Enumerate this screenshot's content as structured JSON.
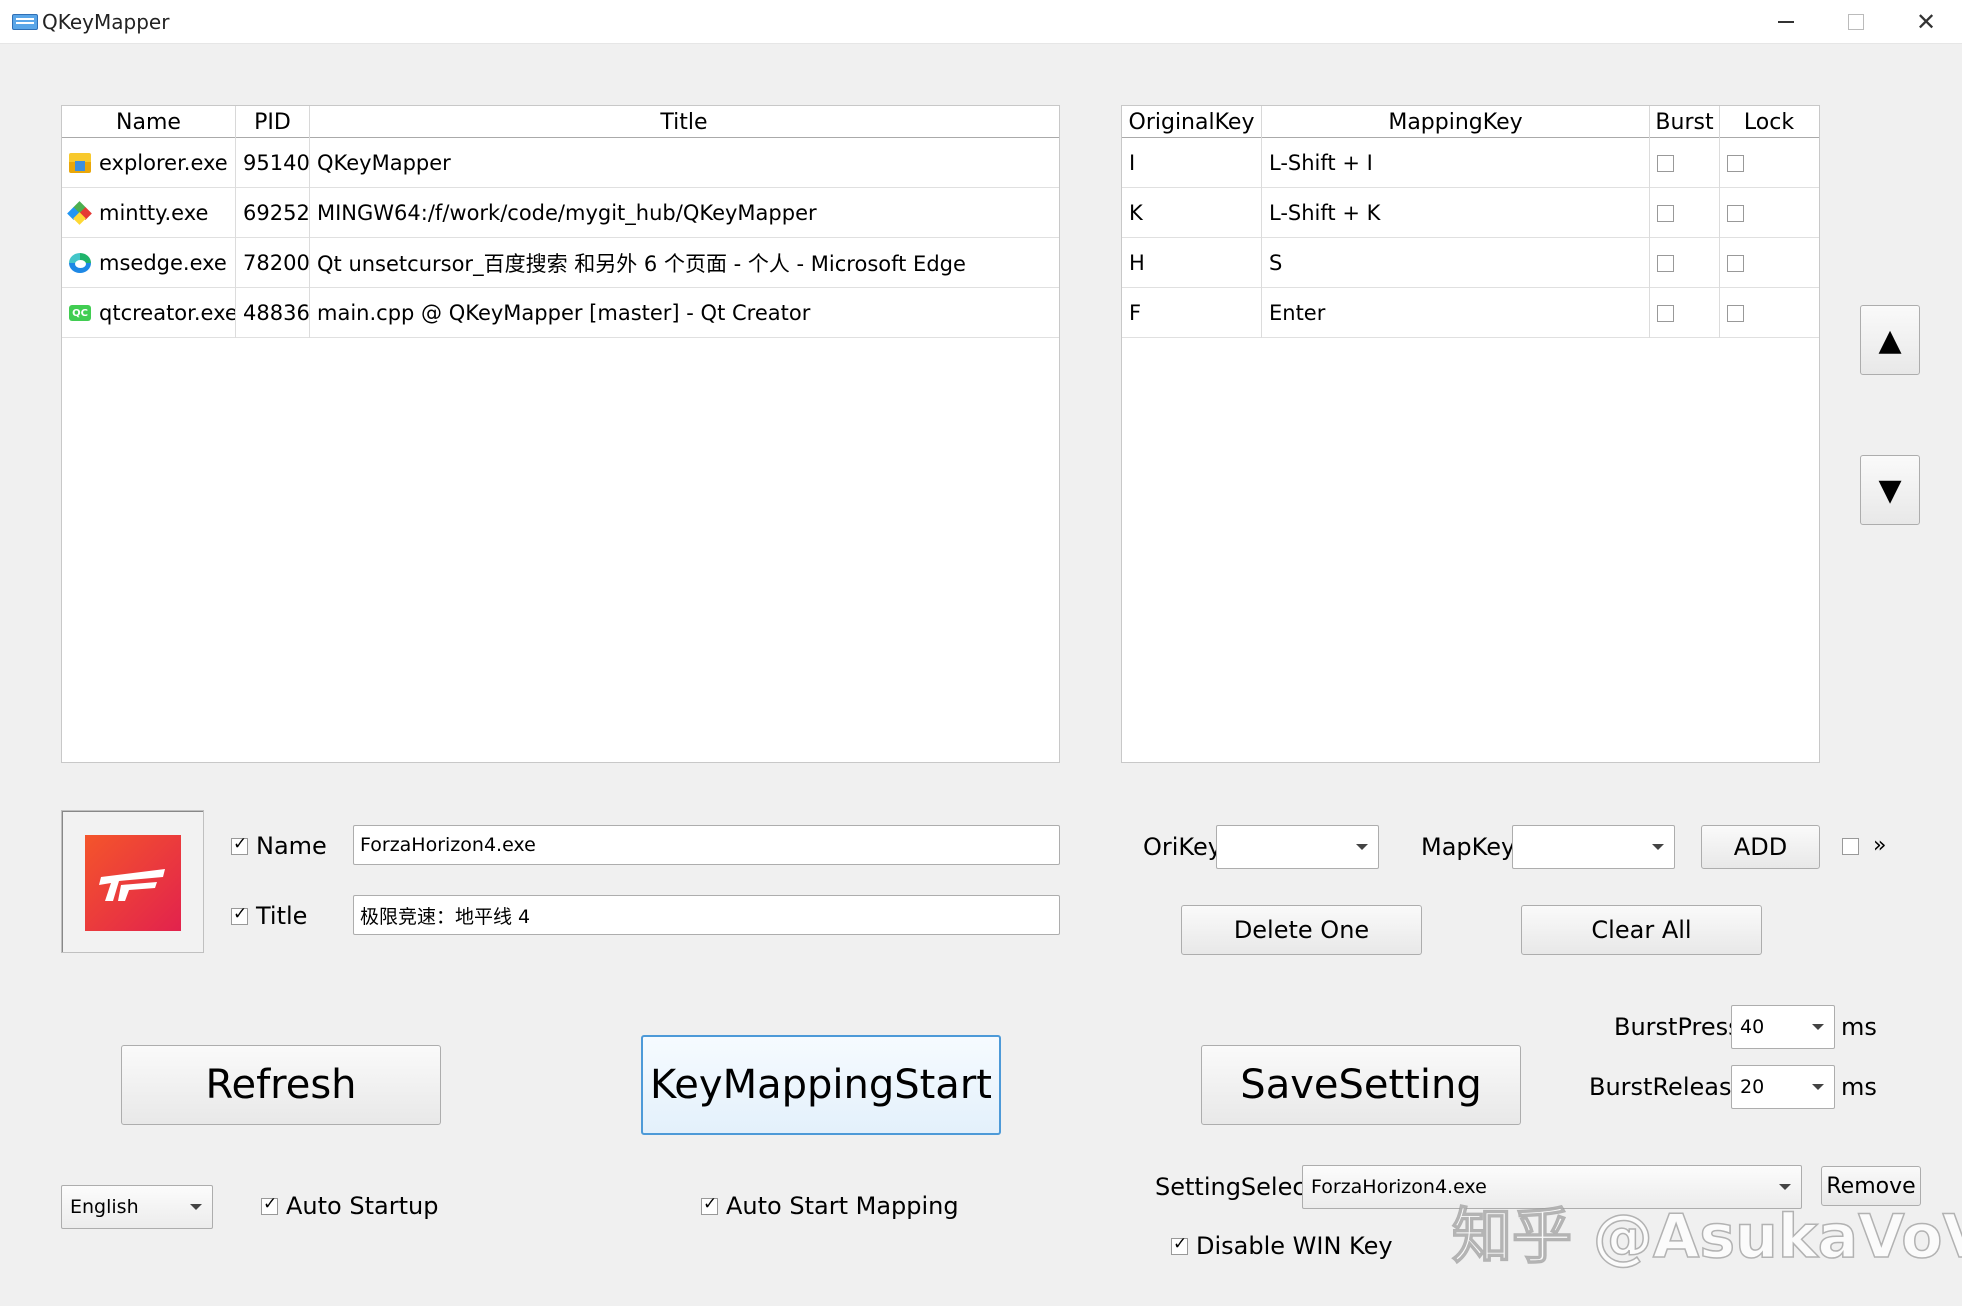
{
  "window": {
    "title": "QKeyMapper",
    "minimize_icon": "minimize-icon",
    "maximize_icon": "maximize-icon",
    "close_glyph": "✕"
  },
  "process_table": {
    "headers": [
      "Name",
      "PID",
      "Title"
    ],
    "rows": [
      {
        "icon": "explorer-icon",
        "name": "explorer.exe",
        "pid": "95140",
        "title": "QKeyMapper"
      },
      {
        "icon": "mintty-icon",
        "name": "mintty.exe",
        "pid": "69252",
        "title": "MINGW64:/f/work/code/mygit_hub/QKeyMapper"
      },
      {
        "icon": "edge-icon",
        "name": "msedge.exe",
        "pid": "78200",
        "title": "Qt unsetcursor_百度搜索 和另外 6 个页面 - 个人 - Microsoft Edge"
      },
      {
        "icon": "qt-creator-icon",
        "name": "qtcreator.exe",
        "pid": "48836",
        "title": "main.cpp @ QKeyMapper [master] - Qt Creator"
      }
    ]
  },
  "mapping_table": {
    "headers": [
      "OriginalKey",
      "MappingKey",
      "Burst",
      "Lock"
    ],
    "rows": [
      {
        "original": "I",
        "mapping": "L-Shift + I",
        "burst": false,
        "lock": false
      },
      {
        "original": "K",
        "mapping": "L-Shift + K",
        "burst": false,
        "lock": false
      },
      {
        "original": "H",
        "mapping": "S",
        "burst": false,
        "lock": false
      },
      {
        "original": "F",
        "mapping": "Enter",
        "burst": false,
        "lock": false
      }
    ]
  },
  "move_buttons": {
    "up": "▲",
    "down": "▼"
  },
  "selected": {
    "icon": "forza-horizon-icon",
    "name_label": "Name",
    "name_checked": true,
    "name_value": "ForzaHorizon4.exe",
    "title_label": "Title",
    "title_checked": true,
    "title_value": "极限竞速：地平线 4"
  },
  "key_editor": {
    "orikey_label": "OriKey",
    "orikey_value": "",
    "mapkey_label": "MapKey",
    "mapkey_value": "",
    "add_label": "ADD",
    "extra_checked": false,
    "extra_glyph": "»",
    "delete_one_label": "Delete One",
    "clear_all_label": "Clear All"
  },
  "actions": {
    "refresh_label": "Refresh",
    "start_label": "KeyMappingStart",
    "save_label": "SaveSetting"
  },
  "burst": {
    "press_label": "BurstPress",
    "press_value": "40",
    "press_unit": "ms",
    "release_label": "BurstRelease",
    "release_value": "20",
    "release_unit": "ms"
  },
  "bottom": {
    "language_value": "English",
    "auto_startup_label": "Auto Startup",
    "auto_startup_checked": true,
    "auto_start_mapping_label": "Auto Start Mapping",
    "auto_start_mapping_checked": true,
    "setting_select_label": "SettingSelect",
    "setting_select_value": "ForzaHorizon4.exe",
    "remove_label": "Remove",
    "disable_win_label": "Disable WIN Key",
    "disable_win_checked": true
  },
  "watermark": "知乎 @AsukaVoV"
}
